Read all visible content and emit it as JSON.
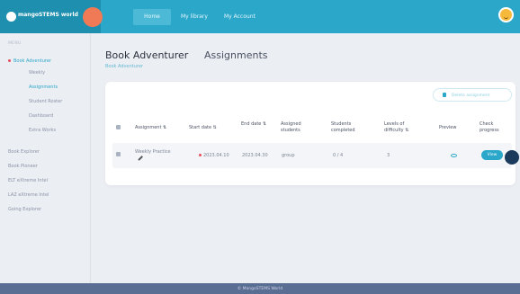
{
  "header": {
    "brand": "mangoSTEMS world",
    "nav": {
      "home": "Home",
      "library": "My library",
      "account": "My Account"
    }
  },
  "sidebar": {
    "header": "MENU",
    "active": "Book Adventurer",
    "sub_items": [
      "Weekly",
      "Assignments",
      "Student Roster",
      "Dashboard",
      "Extra Works"
    ],
    "items": [
      "Book Explorer",
      "Book Pioneer",
      "ELT eXtreme Intel",
      "LAZ eXtreme Intel",
      "Going Explorer"
    ]
  },
  "main": {
    "title": "Book Adventurer",
    "tab": "Assignments",
    "breadcrumb": "Book Adventurer",
    "delete_label": "Delete assignment",
    "table": {
      "headers": {
        "assignment": "Assignment ⇅",
        "start": "Start date ⇅",
        "end": "End date ⇅",
        "assigned": "Assigned students",
        "completed": "Students completed",
        "levels": "Levels of difficulty ⇅",
        "preview": "Preview",
        "check": "Check progress"
      },
      "rows": [
        {
          "assignment": "Weekly Practice",
          "start": "2023.04.10",
          "end": "2023.04.30",
          "assigned": "group",
          "completed": "0 / 4",
          "levels": "3",
          "view": "View"
        }
      ]
    }
  },
  "footer": "© MangoSTEMS World",
  "colors": {
    "accent": "#2aa7c9",
    "footer": "#5a6d93",
    "alert": "#e84c5c"
  }
}
